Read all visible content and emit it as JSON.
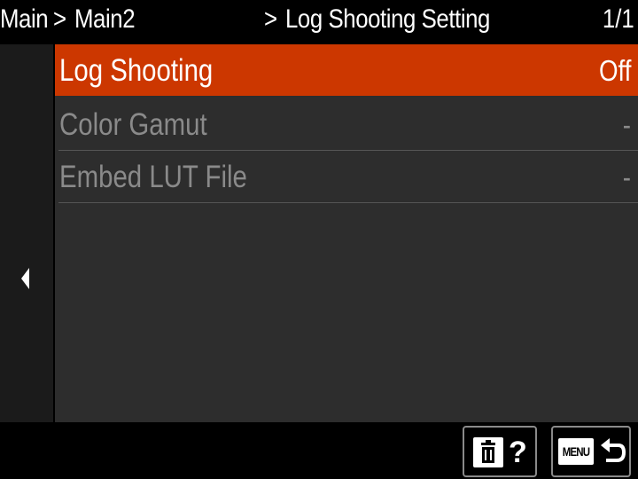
{
  "header": {
    "crumb_main": "Main",
    "crumb_sep_1": ">",
    "crumb_main2": "Main2",
    "crumb_sep_2": ">",
    "title": "Log Shooting Setting",
    "page_indicator": "1/1"
  },
  "sidebar": {
    "back_icon": "chevron-left-icon"
  },
  "menu": {
    "items": [
      {
        "label": "Log Shooting",
        "value": "Off",
        "state": "selected"
      },
      {
        "label": "Color Gamut",
        "value": "-",
        "state": "disabled"
      },
      {
        "label": "Embed LUT File",
        "value": "-",
        "state": "disabled"
      }
    ]
  },
  "footer": {
    "delete_icon": "trash-icon",
    "help_glyph": "?",
    "menu_icon_text": "MENU",
    "return_icon": "return-arrow-icon"
  },
  "colors": {
    "selected_row": "#cc3700",
    "panel_bg": "#2d2d2d",
    "sidebar_bg": "#1b1b1b",
    "disabled_text": "#8a8a8a"
  }
}
